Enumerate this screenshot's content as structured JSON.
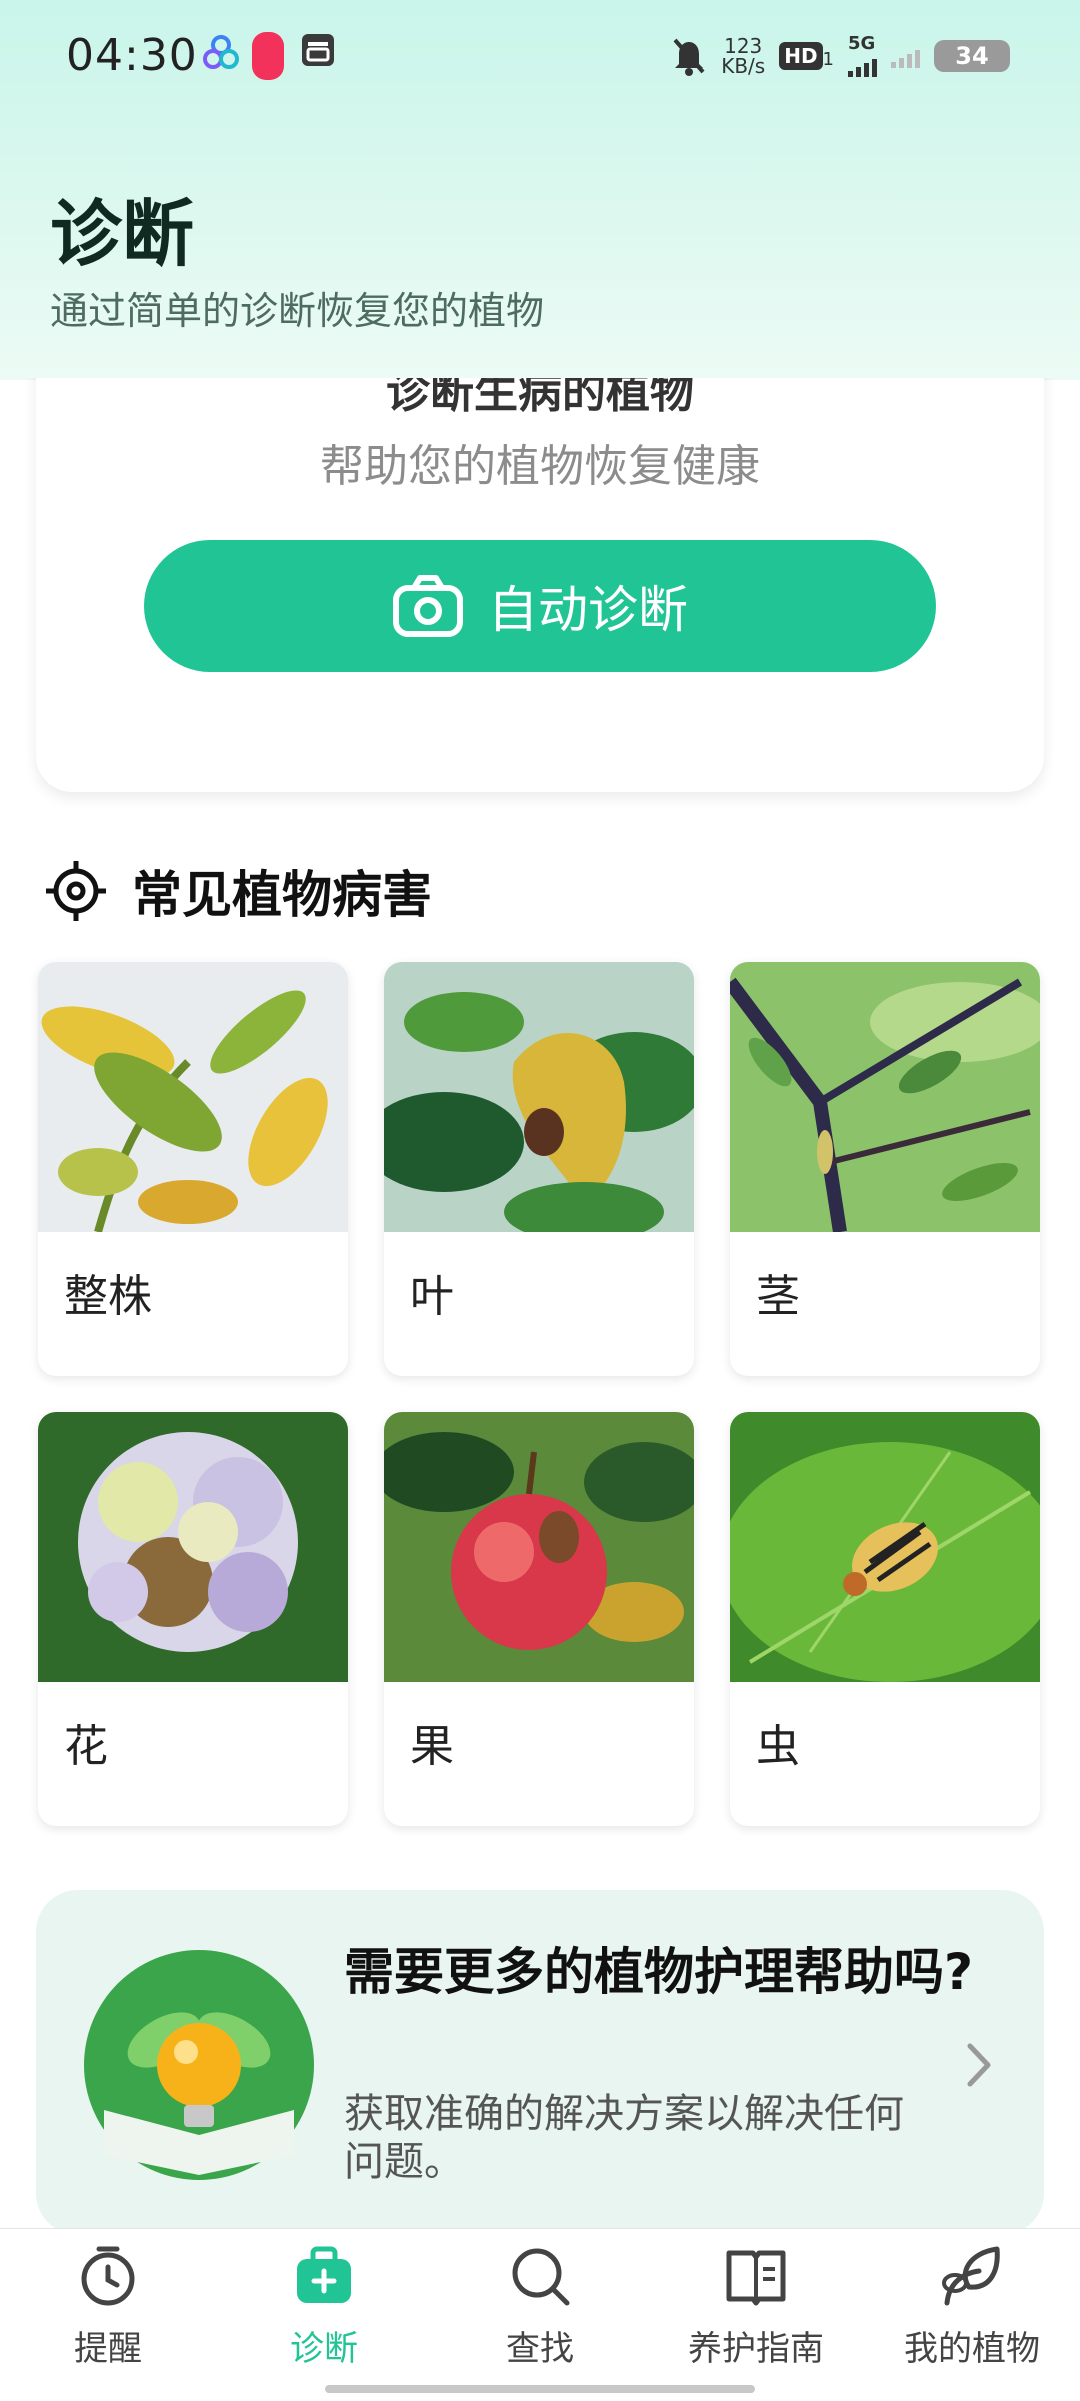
{
  "status_bar": {
    "time": "04:30",
    "net_speed_value": "123",
    "net_speed_unit": "KB/s",
    "hd_badge": "HD",
    "hd_sub": "1",
    "network": "5G",
    "battery": "34"
  },
  "header": {
    "title": "诊断",
    "subtitle": "通过简单的诊断恢复您的植物"
  },
  "auto_card": {
    "title_clipped": "诊断生病的植物",
    "subtitle": "帮助您的植物恢复健康",
    "button_label": "自动诊断"
  },
  "section": {
    "title": "常见植物病害"
  },
  "categories": [
    {
      "label": "整株",
      "image": "yellowing-whole-plant"
    },
    {
      "label": "叶",
      "image": "diseased-leaf"
    },
    {
      "label": "茎",
      "image": "infected-stem"
    },
    {
      "label": "花",
      "image": "wilted-flower"
    },
    {
      "label": "果",
      "image": "damaged-apple"
    },
    {
      "label": "虫",
      "image": "beetle-on-leaf"
    }
  ],
  "help_card": {
    "title": "需要更多的植物护理帮助吗?",
    "text": "获取准确的解决方案以解决任何问题。"
  },
  "bottom_nav": {
    "items": [
      {
        "label": "提醒",
        "icon": "alarm-clock-icon"
      },
      {
        "label": "诊断",
        "icon": "medical-kit-icon"
      },
      {
        "label": "查找",
        "icon": "search-icon"
      },
      {
        "label": "养护指南",
        "icon": "book-icon"
      },
      {
        "label": "我的植物",
        "icon": "leaf-icon"
      }
    ],
    "active_index": 1
  },
  "colors": {
    "accent": "#21c495",
    "header_bg": "#d6f7ec",
    "help_card_bg": "#e8f5f0"
  }
}
